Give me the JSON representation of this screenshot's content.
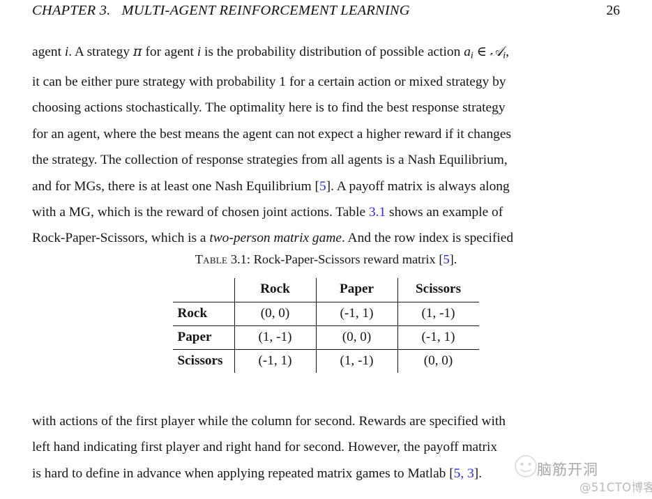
{
  "document": {
    "header": {
      "chapter_title": "CHAPTER 3.   MULTI-AGENT REINFORCEMENT LEARNING",
      "page_number": "26"
    },
    "paragraph_top": {
      "lines": [
        {
          "id": "l1",
          "segments": [
            {
              "text": "agent ",
              "style": "normal"
            },
            {
              "text": "i",
              "style": "math"
            },
            {
              "text": ". A strategy ",
              "style": "normal"
            },
            {
              "text": "π",
              "style": "math"
            },
            {
              "text": " for agent ",
              "style": "normal"
            },
            {
              "text": "i",
              "style": "math"
            },
            {
              "text": " is the probability distribution of possible action ",
              "style": "normal"
            },
            {
              "text": "a",
              "style": "math"
            },
            {
              "text": "i",
              "style": "sub"
            },
            {
              "text": " ∈ ",
              "style": "normal"
            },
            {
              "text": "𝒜",
              "style": "cal"
            },
            {
              "text": "i",
              "style": "sub"
            },
            {
              "text": ",",
              "style": "normal"
            }
          ]
        },
        {
          "id": "l2",
          "segments": [
            {
              "text": "it can be either pure strategy with probability 1 for a certain action or mixed strategy by",
              "style": "normal"
            }
          ]
        },
        {
          "id": "l3",
          "segments": [
            {
              "text": "choosing actions stochastically.  The optimality here is to find the best response strategy",
              "style": "normal"
            }
          ]
        },
        {
          "id": "l4",
          "segments": [
            {
              "text": "for an agent, where the best means the agent can not expect a higher reward if it changes",
              "style": "normal"
            }
          ]
        },
        {
          "id": "l5",
          "segments": [
            {
              "text": "the strategy.  The collection of response strategies from all agents is a Nash Equilibrium,",
              "style": "normal"
            }
          ]
        },
        {
          "id": "l6",
          "segments": [
            {
              "text": "and for MGs, there is at least one Nash Equilibrium [",
              "style": "normal"
            },
            {
              "text": "5",
              "style": "cite"
            },
            {
              "text": "].  A payoff matrix is always along",
              "style": "normal"
            }
          ]
        },
        {
          "id": "l7",
          "segments": [
            {
              "text": "with a MG, which is the reward of chosen joint actions.  Table ",
              "style": "normal"
            },
            {
              "text": "3.1",
              "style": "cite"
            },
            {
              "text": " shows an example of",
              "style": "normal"
            }
          ]
        },
        {
          "id": "l8",
          "segments": [
            {
              "text": "Rock-Paper-Scissors, which is a ",
              "style": "normal"
            },
            {
              "text": "two-person matrix game",
              "style": "italic"
            },
            {
              "text": ".  And the row index is specified",
              "style": "normal"
            }
          ]
        }
      ]
    },
    "table": {
      "caption_label": "Table",
      "caption_number": "3.1:",
      "caption_text": "Rock-Paper-Scissors reward matrix [",
      "caption_citation": "5",
      "caption_tail": "].",
      "column_headers": [
        "",
        "Rock",
        "Paper",
        "Scissors"
      ],
      "rows": [
        {
          "header": "Rock",
          "values": [
            "(0, 0)",
            "(-1, 1)",
            "(1, -1)"
          ]
        },
        {
          "header": "Paper",
          "values": [
            "(1, -1)",
            "(0, 0)",
            "(-1, 1)"
          ]
        },
        {
          "header": "Scissors",
          "values": [
            "(-1, 1)",
            "(1, -1)",
            "(0, 0)"
          ]
        }
      ]
    },
    "paragraph_bottom": {
      "lines": [
        {
          "id": "b1",
          "segments": [
            {
              "text": "with actions of the first player while the column for second.  Rewards are specified with",
              "style": "normal"
            }
          ]
        },
        {
          "id": "b2",
          "segments": [
            {
              "text": "left hand indicating first player and right hand for second.  However, the payoff matrix",
              "style": "normal"
            }
          ]
        },
        {
          "id": "b3",
          "segments": [
            {
              "text": "is hard to define in advance when applying repeated matrix games to Matlab [",
              "style": "normal"
            },
            {
              "text": "5, 3",
              "style": "cite"
            },
            {
              "text": "].",
              "style": "normal"
            }
          ]
        }
      ]
    },
    "watermark": {
      "logo_name": "avatar-circle-logo",
      "chinese_text": "脑筋开洞",
      "tag": "@51CTO博客"
    },
    "colors": {
      "text": "#15151c",
      "citation_link": "#2a2ae6",
      "rule": "#15151c",
      "watermark": "#b9b9bf",
      "background": "#ffffff"
    }
  }
}
